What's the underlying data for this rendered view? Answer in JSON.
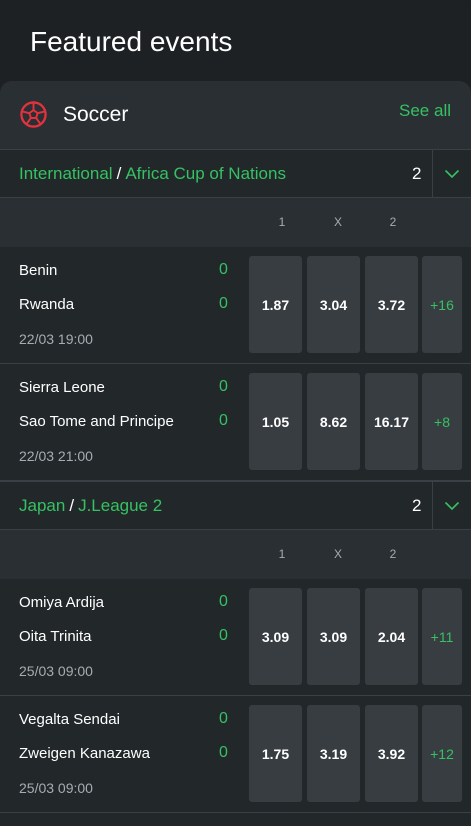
{
  "page": {
    "title": "Featured events"
  },
  "sport": {
    "name": "Soccer",
    "icon": "soccer-ball-icon",
    "see_all": "See all"
  },
  "colors": {
    "accent": "#36c163",
    "background": "#1d2124",
    "card": "#2a2f33",
    "odd_button": "#383d42"
  },
  "columns": [
    "1",
    "X",
    "2"
  ],
  "leagues": [
    {
      "region": "International",
      "separator": "/",
      "name": "Africa Cup of Nations",
      "count": "2",
      "matches": [
        {
          "home": "Benin",
          "away": "Rwanda",
          "home_score": "0",
          "away_score": "0",
          "time": "22/03 19:00",
          "odds": [
            "1.87",
            "3.04",
            "3.72"
          ],
          "more": "+16"
        },
        {
          "home": "Sierra Leone",
          "away": "Sao Tome and Principe",
          "home_score": "0",
          "away_score": "0",
          "time": "22/03 21:00",
          "odds": [
            "1.05",
            "8.62",
            "16.17"
          ],
          "more": "+8"
        }
      ]
    },
    {
      "region": "Japan",
      "separator": "/",
      "name": "J.League 2",
      "count": "2",
      "matches": [
        {
          "home": "Omiya Ardija",
          "away": "Oita Trinita",
          "home_score": "0",
          "away_score": "0",
          "time": "25/03 09:00",
          "odds": [
            "3.09",
            "3.09",
            "2.04"
          ],
          "more": "+11"
        },
        {
          "home": "Vegalta Sendai",
          "away": "Zweigen Kanazawa",
          "home_score": "0",
          "away_score": "0",
          "time": "25/03 09:00",
          "odds": [
            "1.75",
            "3.19",
            "3.92"
          ],
          "more": "+12"
        }
      ]
    }
  ]
}
